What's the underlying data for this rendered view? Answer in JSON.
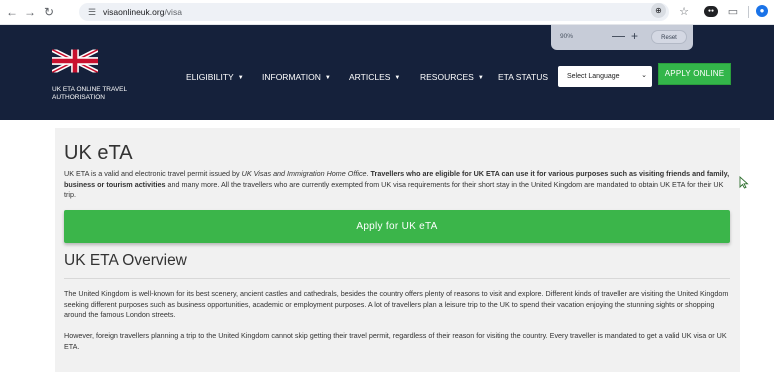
{
  "browser": {
    "url_domain": "visaonlineuk.org",
    "url_path": "/visa",
    "icons": {
      "back": "arrow-left-icon",
      "forward": "arrow-right-icon",
      "reload": "reload-icon",
      "site_info": "tune-icon",
      "zoom": "zoom-icon",
      "bookmark": "star-icon",
      "extension": "extension-icon",
      "extensions_menu": "puzzle-icon",
      "profile": "profile-icon"
    }
  },
  "zoom_popup": {
    "level": "90%",
    "minus": "—",
    "plus": "+",
    "reset": "Reset"
  },
  "header": {
    "brand_line1": "UK ETA ONLINE TRAVEL",
    "brand_line2": "AUTHORISATION",
    "nav": [
      {
        "label": "ELIGIBILITY",
        "has_caret": true
      },
      {
        "label": "INFORMATION",
        "has_caret": true
      },
      {
        "label": "ARTICLES",
        "has_caret": true
      },
      {
        "label": "RESOURCES",
        "has_caret": true
      },
      {
        "label": "ETA STATUS",
        "has_caret": false
      }
    ],
    "language_select": "Select Language",
    "apply_button": "APPLY ONLINE",
    "bg_color": "#15213b"
  },
  "content": {
    "title": "UK eTA",
    "intro": {
      "p1": "UK ETA is a valid and electronic travel permit issued by ",
      "p1_em": "UK Visas and Immigration Home Office",
      "p1_dot": ". ",
      "p1_strong": "Travellers who are eligible for UK ETA can use it for various purposes such as visiting friends and family, business or tourism activities",
      "p1_rest": " and many more. All the travellers who are currently exempted from UK visa requirements for their short stay in the United Kingdom are mandated to obtain UK ETA for their UK trip."
    },
    "apply_eta_button": "Apply for UK eTA",
    "overview_title": "UK ETA Overview",
    "overview_p1": "The United Kingdom is well-known for its best scenery, ancient castles and cathedrals, besides the country offers plenty of reasons to visit and explore. Different kinds of traveller are visiting the United Kingdom seeking different purposes such as business opportunities, academic or employment purposes. A lot of travellers plan a leisure trip to the UK to spend their vacation enjoying the stunning sights or shopping around the famous London streets.",
    "overview_p2": "However, foreign travellers planning a trip to the United Kingdom cannot skip getting their travel permit, regardless of their reason for visiting the country. Every traveller is mandated to get a valid UK visa or UK ETA.",
    "accent_green": "#3bb54a"
  }
}
